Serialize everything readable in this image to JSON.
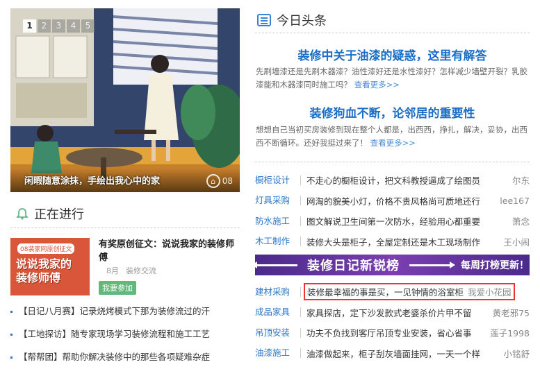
{
  "slider": {
    "pages": [
      "1",
      "2",
      "3",
      "4",
      "5"
    ],
    "active_page": "1",
    "caption": "闲暇随意涂抹，手绘出我心中的家",
    "logo_text": "08"
  },
  "ongoing": {
    "title": "正在进行",
    "icon": "bell-icon",
    "promo": {
      "image_tag": "08装家网原创征文",
      "image_text_1": "说说我家的",
      "image_text_2": "装修师傅",
      "title": "有奖原创征文：说说我家的装修师傅",
      "month": "8月",
      "category": "装修交流",
      "join_label": "我要参加"
    },
    "items": [
      "【日记八月赛】记录烧烤模式下那为装修流过的汗",
      "【工地探访】随专家现场学习装修流程和施工工艺",
      "【帮帮团】帮助你解决装修中的那些各项疑难杂症"
    ]
  },
  "headlines": {
    "title": "今日头条",
    "icon": "newspaper-icon",
    "top": [
      {
        "title": "装修中关于油漆的疑惑，这里有解答",
        "summary": "先刷墙漆还是先刷木器漆？油性漆好还是水性漆好？怎样减少墙壁开裂？乳胶漆能和木器漆同时施工吗？",
        "more": "查看更多>>"
      },
      {
        "title": "装修狗血不断，论邻居的重要性",
        "summary": "想想自己当初买房装修到现在整个人都是，出西西，挣扎，解决，妥协，出西西不断循环。还好我挺过来了！",
        "more": "查看更多>>"
      }
    ],
    "rows_a": [
      {
        "cat": "橱柜设计",
        "text": "不走心的橱柜设计，把文科教授逼成了绘图员",
        "author": "尔东"
      },
      {
        "cat": "灯具采购",
        "text": "网淘的貌美小灯，价格不贵风格尚可质地还行",
        "author": "lee167"
      },
      {
        "cat": "防水施工",
        "text": "图文解说卫生间第一次防水，经验用心都重要",
        "author": "箫念"
      },
      {
        "cat": "木工制作",
        "text": "装修大头是柜子，全屋定制还是木工现场制作",
        "author": "王小闹"
      }
    ],
    "banner": {
      "main": "装修日记新锐榜",
      "sub": "每周打榜更新！"
    },
    "rows_b": [
      {
        "cat": "建材采购",
        "text": "装修最幸福的事是买，一见钟情的浴室柜",
        "author": "我爱小花园",
        "highlight": true
      },
      {
        "cat": "成品家具",
        "text": "家具探店，定下沙发款式老婆杀价片甲不留",
        "author": "黄老邪75"
      },
      {
        "cat": "吊顶安装",
        "text": "功夫不负找到客厅吊顶专业安装，省心省事",
        "author": "莲子1998"
      },
      {
        "cat": "油漆施工",
        "text": "油漆做起来，柜子刮灰墙面挂网，一天一个样",
        "author": "小铭舒"
      }
    ]
  }
}
